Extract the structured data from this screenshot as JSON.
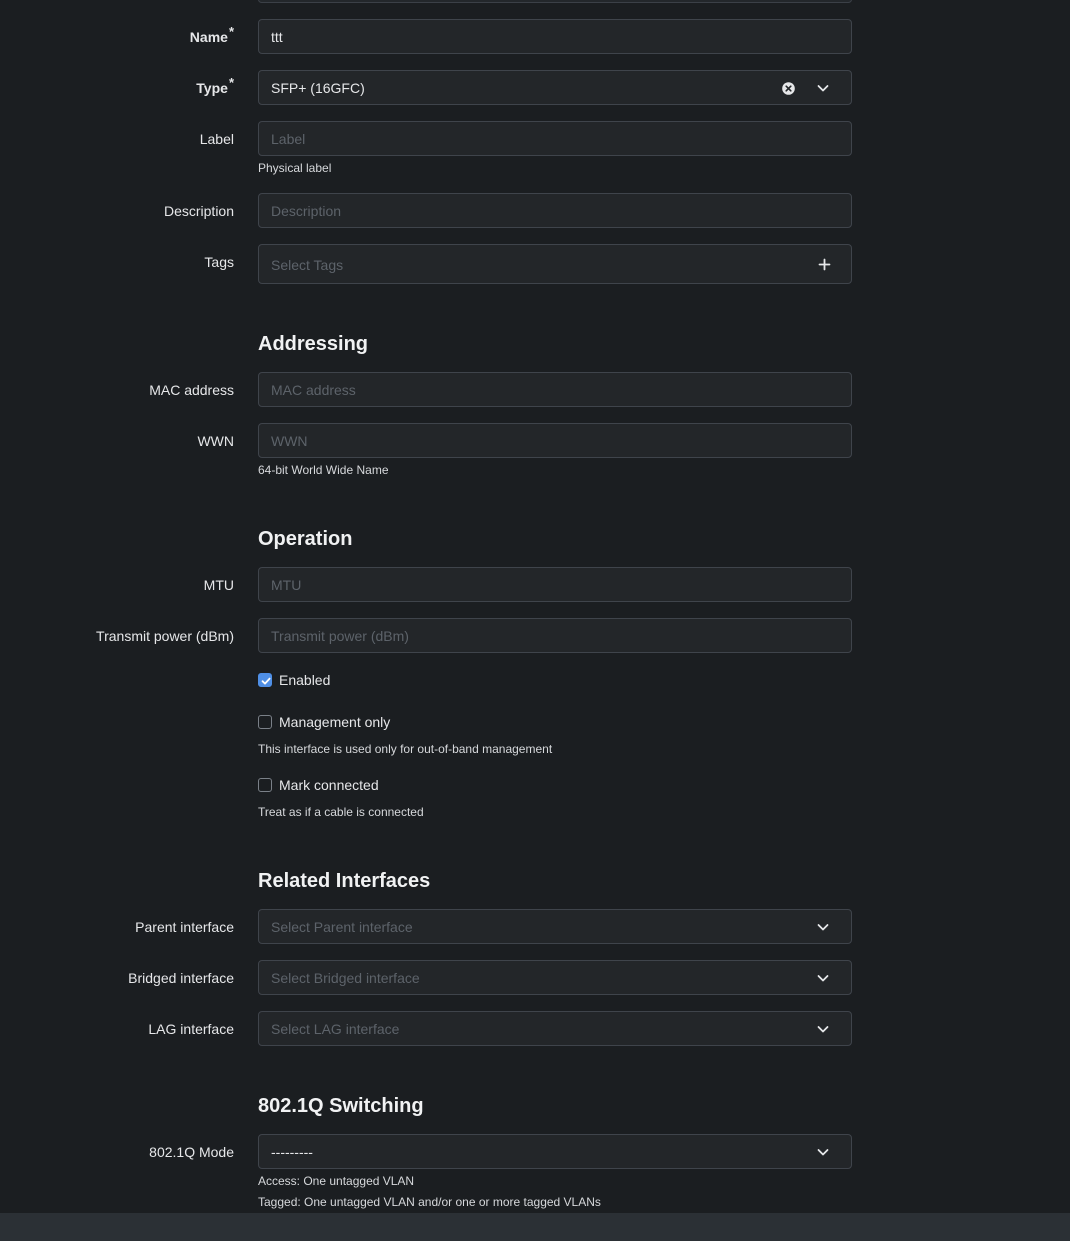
{
  "form": {
    "name": {
      "label": "Name",
      "required": "*",
      "value": "ttt"
    },
    "type": {
      "label": "Type",
      "required": "*",
      "value": "SFP+ (16GFC)"
    },
    "label": {
      "label": "Label",
      "placeholder": "Label",
      "help": "Physical label"
    },
    "description": {
      "label": "Description",
      "placeholder": "Description"
    },
    "tags": {
      "label": "Tags",
      "placeholder": "Select Tags"
    }
  },
  "addressing": {
    "title": "Addressing",
    "mac": {
      "label": "MAC address",
      "placeholder": "MAC address"
    },
    "wwn": {
      "label": "WWN",
      "placeholder": "WWN",
      "help": "64-bit World Wide Name"
    }
  },
  "operation": {
    "title": "Operation",
    "mtu": {
      "label": "MTU",
      "placeholder": "MTU"
    },
    "tx_power": {
      "label": "Transmit power (dBm)",
      "placeholder": "Transmit power (dBm)"
    },
    "enabled": {
      "label": "Enabled",
      "checked": true
    },
    "mgmt_only": {
      "label": "Management only",
      "checked": false,
      "help": "This interface is used only for out-of-band management"
    },
    "mark_connected": {
      "label": "Mark connected",
      "checked": false,
      "help": "Treat as if a cable is connected"
    }
  },
  "related": {
    "title": "Related Interfaces",
    "parent": {
      "label": "Parent interface",
      "placeholder": "Select Parent interface"
    },
    "bridged": {
      "label": "Bridged interface",
      "placeholder": "Select Bridged interface"
    },
    "lag": {
      "label": "LAG interface",
      "placeholder": "Select LAG interface"
    }
  },
  "switching": {
    "title": "802.1Q Switching",
    "mode": {
      "label": "802.1Q Mode",
      "value": "---------"
    },
    "help_access": "Access: One untagged VLAN",
    "help_tagged": "Tagged: One untagged VLAN and/or one or more tagged VLANs"
  },
  "colors": {
    "background": "#1b1e21",
    "field_bg": "#232629",
    "border": "#3f444b",
    "accent": "#4f8fe6"
  },
  "icons": [
    "chevron-down-icon",
    "clear-icon",
    "plus-icon",
    "checkmark-icon"
  ]
}
